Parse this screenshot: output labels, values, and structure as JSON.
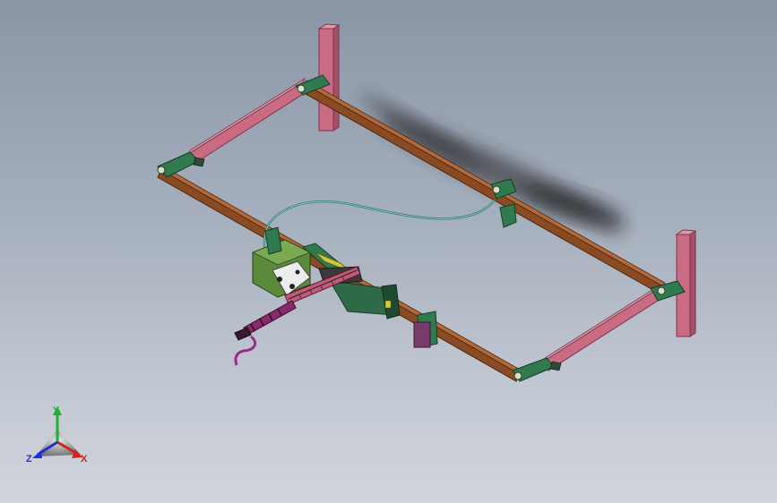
{
  "view": {
    "background_top": "#8a95a6",
    "background_bottom": "#d0d4dc"
  },
  "model": {
    "frame_post_color": "#c96b82",
    "long_beam_color": "#8a4a22",
    "short_beam_color": "#c96b82",
    "bracket_color": "#2f7a4f",
    "carriage_color": "#5a8a3a",
    "torch_color": "#8a2a6a",
    "hose_color": "#3a7f7a"
  },
  "triad": {
    "y_label": "Y",
    "x_label": "X",
    "z_label": "Z",
    "y_color": "#1fb030",
    "x_color": "#d42020",
    "z_color": "#2030d0"
  }
}
